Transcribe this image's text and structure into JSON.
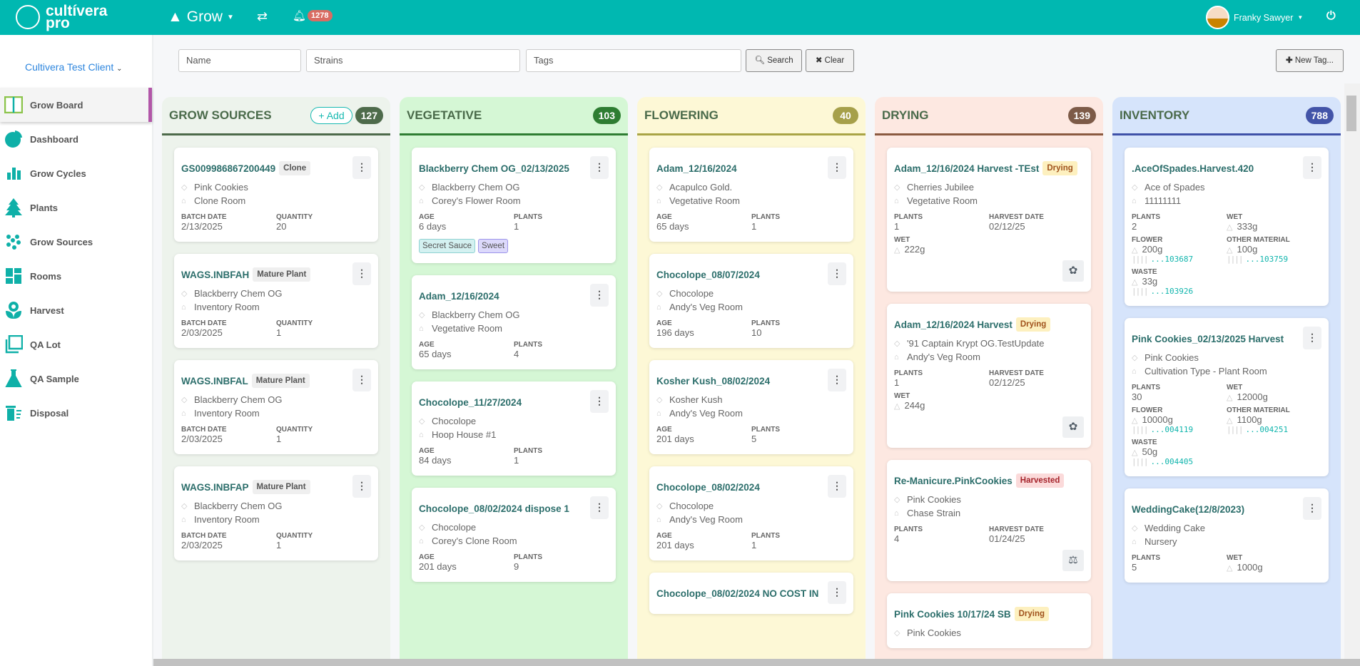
{
  "header": {
    "logo_line1": "cultívera",
    "logo_line2": "pro",
    "module": "Grow",
    "notifications": "1278",
    "user": "Franky Sawyer",
    "accent": "#00b8b1"
  },
  "sidebar": {
    "client": "Cultivera Test Client",
    "items": [
      {
        "label": "Grow Board",
        "icon": "grow-board-icon",
        "active": true
      },
      {
        "label": "Dashboard",
        "icon": "pie-chart-icon"
      },
      {
        "label": "Grow Cycles",
        "icon": "bar-chart-icon"
      },
      {
        "label": "Plants",
        "icon": "tree-icon"
      },
      {
        "label": "Grow Sources",
        "icon": "seeds-icon"
      },
      {
        "label": "Rooms",
        "icon": "rooms-icon"
      },
      {
        "label": "Harvest",
        "icon": "flower-icon"
      },
      {
        "label": "QA Lot",
        "icon": "copy-icon"
      },
      {
        "label": "QA Sample",
        "icon": "flask-icon"
      },
      {
        "label": "Disposal",
        "icon": "trash-icon"
      }
    ]
  },
  "filters": {
    "name_placeholder": "Name",
    "strains_placeholder": "Strains",
    "tags_placeholder": "Tags",
    "search": "Search",
    "clear": "Clear",
    "new_tag": "New Tag..."
  },
  "columns": [
    {
      "title": "GROW SOURCES",
      "count": "127",
      "add": "Add",
      "bg": "#edf3ec",
      "line": "#4d6a4a",
      "badge": "#4e6b4b",
      "cards": [
        {
          "title": "GS009986867200449",
          "badge": "Clone",
          "strain": "Pink Cookies",
          "room": "Clone Room",
          "stats": [
            {
              "label": "BATCH DATE",
              "value": "2/13/2025"
            },
            {
              "label": "QUANTITY",
              "value": "20"
            }
          ]
        },
        {
          "title": "WAGS.INBFAH",
          "badge": "Mature Plant",
          "strain": "Blackberry Chem OG",
          "room": "Inventory Room",
          "stats": [
            {
              "label": "BATCH DATE",
              "value": "2/03/2025"
            },
            {
              "label": "QUANTITY",
              "value": "1"
            }
          ]
        },
        {
          "title": "WAGS.INBFAL",
          "badge": "Mature Plant",
          "strain": "Blackberry Chem OG",
          "room": "Inventory Room",
          "stats": [
            {
              "label": "BATCH DATE",
              "value": "2/03/2025"
            },
            {
              "label": "QUANTITY",
              "value": "1"
            }
          ]
        },
        {
          "title": "WAGS.INBFAP",
          "badge": "Mature Plant",
          "strain": "Blackberry Chem OG",
          "room": "Inventory Room",
          "stats": [
            {
              "label": "BATCH DATE",
              "value": "2/03/2025"
            },
            {
              "label": "QUANTITY",
              "value": "1"
            }
          ]
        }
      ]
    },
    {
      "title": "VEGETATIVE",
      "count": "103",
      "bg": "#d5f7d5",
      "line": "#2e7d32",
      "badge": "#2e7d32",
      "cards": [
        {
          "title": "Blackberry Chem OG_02/13/2025",
          "strain": "Blackberry Chem OG",
          "room": "Corey's Flower Room",
          "stats": [
            {
              "label": "AGE",
              "value": "6 days"
            },
            {
              "label": "PLANTS",
              "value": "1"
            }
          ],
          "tags": [
            {
              "label": "Secret Sauce",
              "bg": "#d4f1f1",
              "border": "#8fd3d3"
            },
            {
              "label": "Sweet",
              "bg": "#dcd9fb",
              "border": "#9d95ea"
            }
          ]
        },
        {
          "title": "Adam_12/16/2024",
          "strain": "Blackberry Chem OG",
          "room": "Vegetative Room",
          "stats": [
            {
              "label": "AGE",
              "value": "65 days"
            },
            {
              "label": "PLANTS",
              "value": "4"
            }
          ]
        },
        {
          "title": "Chocolope_11/27/2024",
          "strain": "Chocolope",
          "room": "Hoop House #1",
          "stats": [
            {
              "label": "AGE",
              "value": "84 days"
            },
            {
              "label": "PLANTS",
              "value": "1"
            }
          ]
        },
        {
          "title": "Chocolope_08/02/2024 dispose 1",
          "strain": "Chocolope",
          "room": "Corey's Clone Room",
          "stats": [
            {
              "label": "AGE",
              "value": "201 days"
            },
            {
              "label": "PLANTS",
              "value": "9"
            }
          ]
        }
      ]
    },
    {
      "title": "FLOWERING",
      "count": "40",
      "bg": "#fdf8d6",
      "line": "#a9a445",
      "badge": "#a6a04a",
      "cards": [
        {
          "title": "Adam_12/16/2024",
          "strain": "Acapulco Gold.",
          "room": "Vegetative Room",
          "stats": [
            {
              "label": "AGE",
              "value": "65 days"
            },
            {
              "label": "PLANTS",
              "value": "1"
            }
          ]
        },
        {
          "title": "Chocolope_08/07/2024",
          "strain": "Chocolope",
          "room": "Andy's Veg Room",
          "stats": [
            {
              "label": "AGE",
              "value": "196 days"
            },
            {
              "label": "PLANTS",
              "value": "10"
            }
          ]
        },
        {
          "title": "Kosher Kush_08/02/2024",
          "strain": "Kosher Kush",
          "room": "Andy's Veg Room",
          "stats": [
            {
              "label": "AGE",
              "value": "201 days"
            },
            {
              "label": "PLANTS",
              "value": "5"
            }
          ]
        },
        {
          "title": "Chocolope_08/02/2024",
          "strain": "Chocolope",
          "room": "Andy's Veg Room",
          "stats": [
            {
              "label": "AGE",
              "value": "201 days"
            },
            {
              "label": "PLANTS",
              "value": "1"
            }
          ]
        },
        {
          "title": "Chocolope_08/02/2024 NO COST IN",
          "strain": "",
          "room": "",
          "stats": []
        }
      ]
    },
    {
      "title": "DRYING",
      "count": "139",
      "bg": "#fde8e1",
      "line": "#8b5a40",
      "badge": "#7d5b48",
      "cards": [
        {
          "title": "Adam_12/16/2024 Harvest -TEst",
          "badge": "Drying",
          "badge_type": "drying",
          "nokebab": true,
          "strain": "Cherries Jubilee",
          "room": "Vegetative Room",
          "stats": [
            {
              "label": "PLANTS",
              "value": "1"
            },
            {
              "label": "HARVEST DATE",
              "value": "02/12/25"
            },
            {
              "label": "WET",
              "value": "222g",
              "weight": true
            }
          ],
          "action": "leaf-icon"
        },
        {
          "title": "Adam_12/16/2024 Harvest",
          "badge": "Drying",
          "badge_type": "drying",
          "nokebab": true,
          "strain": "'91 Captain Krypt OG.TestUpdate",
          "room": "Andy's Veg Room",
          "stats": [
            {
              "label": "PLANTS",
              "value": "1"
            },
            {
              "label": "HARVEST DATE",
              "value": "02/12/25"
            },
            {
              "label": "WET",
              "value": "244g",
              "weight": true
            }
          ],
          "action": "leaf-icon"
        },
        {
          "title": "Re-Manicure.PinkCookies",
          "badge": "Harvested",
          "badge_type": "harvested",
          "nokebab": true,
          "strain": "Pink Cookies",
          "room": "Chase Strain",
          "stats": [
            {
              "label": "PLANTS",
              "value": "4"
            },
            {
              "label": "HARVEST DATE",
              "value": "01/24/25"
            }
          ],
          "action": "scale-icon"
        },
        {
          "title": "Pink Cookies 10/17/24 SB",
          "badge": "Drying",
          "badge_type": "drying",
          "nokebab": true,
          "strain": "Pink Cookies",
          "room": "",
          "stats": []
        }
      ]
    },
    {
      "title": "INVENTORY",
      "count": "788",
      "bg": "#d6e4fb",
      "line": "#3f51a8",
      "badge": "#4354a8",
      "cards": [
        {
          "title": ".AceOfSpades.Harvest.420",
          "strain": "Ace of Spades",
          "room": "11111111",
          "stats": [
            {
              "label": "PLANTS",
              "value": "2"
            },
            {
              "label": "WET",
              "value": "333g",
              "weight": true
            },
            {
              "label": "FLOWER",
              "value": "200g",
              "weight": true,
              "barcode": "...103687"
            },
            {
              "label": "OTHER MATERIAL",
              "value": "100g",
              "weight": true,
              "barcode": "...103759"
            },
            {
              "label": "WASTE",
              "value": "33g",
              "weight": true,
              "barcode": "...103926"
            }
          ]
        },
        {
          "title": "Pink Cookies_02/13/2025 Harvest",
          "strain": "Pink Cookies",
          "room": "Cultivation Type - Plant Room",
          "stats": [
            {
              "label": "PLANTS",
              "value": "30"
            },
            {
              "label": "WET",
              "value": "12000g",
              "weight": true
            },
            {
              "label": "FLOWER",
              "value": "10000g",
              "weight": true,
              "barcode": "...004119"
            },
            {
              "label": "OTHER MATERIAL",
              "value": "1100g",
              "weight": true,
              "barcode": "...004251"
            },
            {
              "label": "WASTE",
              "value": "50g",
              "weight": true,
              "barcode": "...004405"
            }
          ]
        },
        {
          "title": "WeddingCake(12/8/2023)",
          "strain": "Wedding Cake",
          "room": "Nursery",
          "stats": [
            {
              "label": "PLANTS",
              "value": "5"
            },
            {
              "label": "WET",
              "value": "1000g",
              "weight": true
            }
          ]
        }
      ]
    }
  ]
}
